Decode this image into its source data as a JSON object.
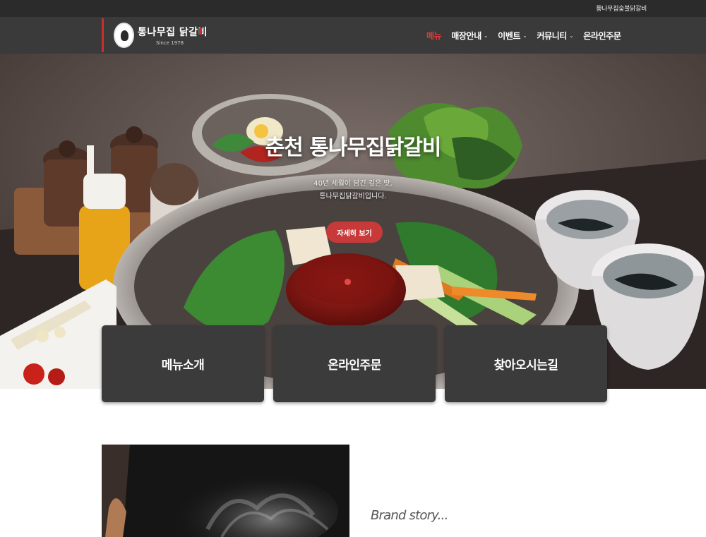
{
  "topbar": {
    "link": "통나무집숯불닭갈비"
  },
  "header": {
    "logo": {
      "title": "통나무집 닭갈비",
      "since": "Since 1978"
    },
    "nav": [
      {
        "label": "메뉴",
        "active": true,
        "dropdown": false
      },
      {
        "label": "매장안내",
        "active": false,
        "dropdown": true
      },
      {
        "label": "이벤트",
        "active": false,
        "dropdown": true
      },
      {
        "label": "커뮤니티",
        "active": false,
        "dropdown": true
      },
      {
        "label": "온라인주문",
        "active": false,
        "dropdown": false
      }
    ]
  },
  "hero": {
    "title": "춘천 통나무집닭갈비",
    "subtitle_line1": "40년 세월이 담긴 깊은 맛,",
    "subtitle_line2": "통나무집닭갈비입니다.",
    "button": "자세히 보기"
  },
  "cards": [
    {
      "label": "메뉴소개"
    },
    {
      "label": "온라인주문"
    },
    {
      "label": "찾아오시는길"
    }
  ],
  "story": {
    "label": "Brand story..."
  },
  "colors": {
    "accent": "#c73a39",
    "nav_active": "#e23d3d",
    "header_bg": "#3a3a3a",
    "topbar_bg": "#2b2b2b",
    "card_bg": "#3b3b3b"
  },
  "icons": {
    "nav_caret": "chevron-down-icon"
  }
}
